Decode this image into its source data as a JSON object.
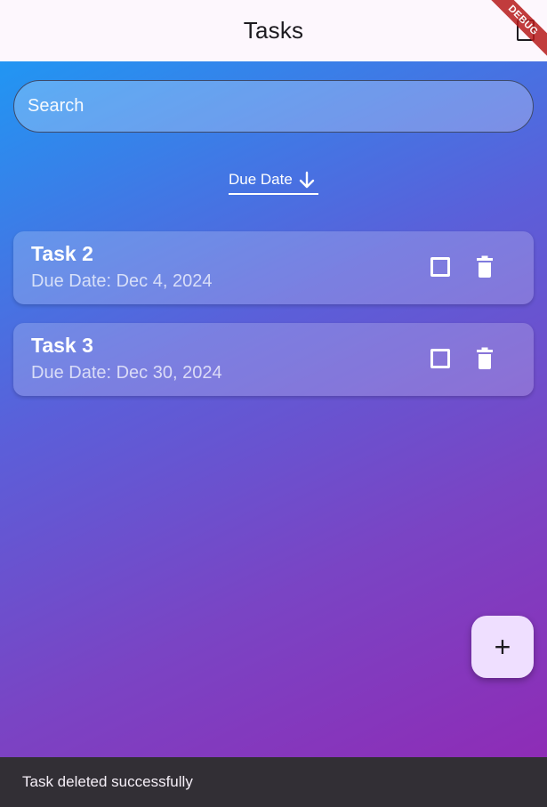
{
  "appbar": {
    "title": "Tasks",
    "debug_label": "DEBUG"
  },
  "search": {
    "placeholder": "Search"
  },
  "sort": {
    "label": "Due Date",
    "direction_icon": "arrow-down-icon"
  },
  "tasks": [
    {
      "title": "Task 2",
      "due": "Due Date: Dec 4, 2024",
      "completed": false
    },
    {
      "title": "Task 3",
      "due": "Due Date: Dec 30, 2024",
      "completed": false
    }
  ],
  "fab": {
    "label": "+"
  },
  "snackbar": {
    "message": "Task deleted successfully"
  },
  "colors": {
    "gradient_start": "#2196f3",
    "gradient_end": "#8e2cb6",
    "fab_bg": "#efdfff",
    "snackbar_bg": "#322f35"
  }
}
